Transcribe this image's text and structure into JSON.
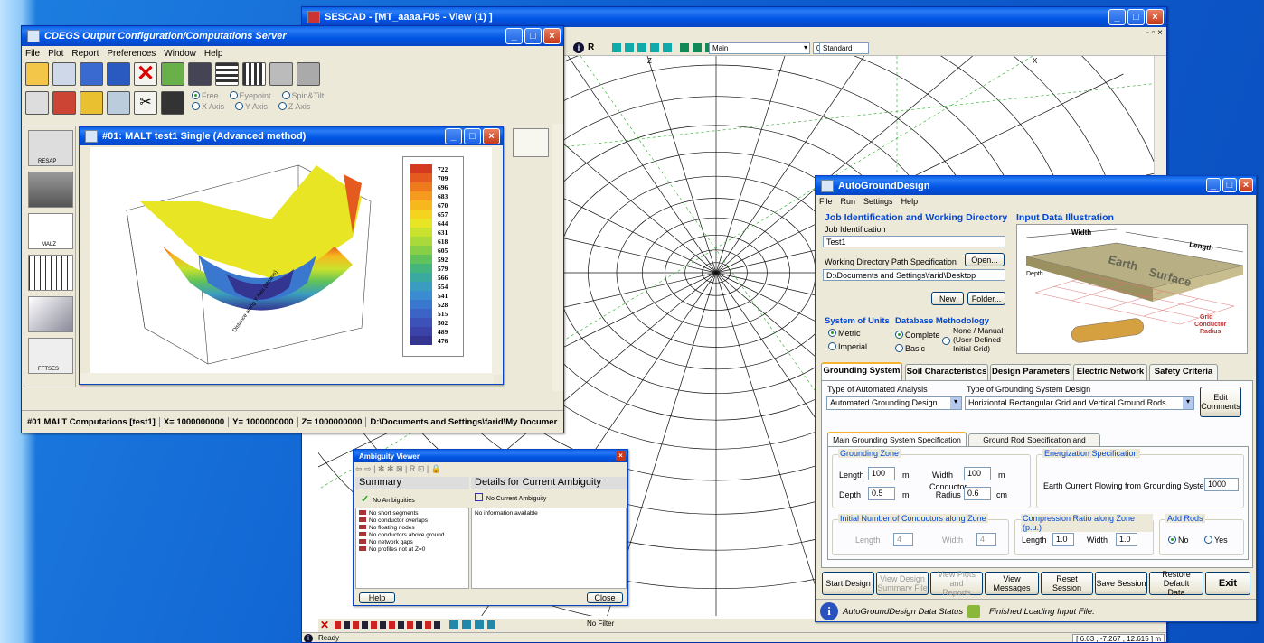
{
  "sescad": {
    "title": "SESCAD - [MT_aaaa.F05 - View (1) ]",
    "toolbar": {
      "view_select": "Main",
      "zoom_value": "0.5",
      "style_select": "Standard"
    },
    "axis_labels": [
      "Z",
      "X"
    ],
    "status_text": "Ready",
    "coords": "[  6.03  ,  -7.267  ,  12.615  ] m",
    "bottom_toolbar_filter": "No Filter"
  },
  "cdegs": {
    "title": "CDEGS Output Configuration/Computations  Server",
    "menu": [
      "File",
      "Plot",
      "Report",
      "Preferences",
      "Window",
      "Help"
    ],
    "view_options": [
      {
        "label": "Free",
        "selected": true
      },
      {
        "label": "Eyepoint",
        "selected": false
      },
      {
        "label": "Spin&Tilt",
        "selected": false
      },
      {
        "label": "X Axis",
        "selected": false
      },
      {
        "label": "Y Axis",
        "selected": false
      },
      {
        "label": "Z Axis",
        "selected": false
      }
    ],
    "side_tools": [
      "RESAP",
      "",
      "MALZ",
      "",
      "",
      "FFTSES"
    ],
    "plot_title": "#01: MALT test1 Single (Advanced method)",
    "axis_text": "Distance along Y Axis (Meters)",
    "legend_values": [
      "722",
      "709",
      "696",
      "683",
      "670",
      "657",
      "644",
      "631",
      "618",
      "605",
      "592",
      "579",
      "566",
      "554",
      "541",
      "528",
      "515",
      "502",
      "489",
      "476"
    ],
    "legend_colors": [
      "#d43a1f",
      "#e55a1f",
      "#ee7a1e",
      "#f59a1e",
      "#f7b81e",
      "#f4d41e",
      "#e7e524",
      "#c9e22d",
      "#a9d93a",
      "#87cf47",
      "#5fc25a",
      "#43b57d",
      "#3aa9a0",
      "#3a9cc0",
      "#3a8bd0",
      "#3a78d0",
      "#3b64c6",
      "#3c52b8",
      "#3b43a8",
      "#343590"
    ],
    "status": {
      "computation": "#01 MALT Computations [test1]",
      "x": "X= 1000000000",
      "y": "Y= 1000000000",
      "z": "Z= 1000000000",
      "path": "D:\\Documents and Settings\\farid\\My Documer"
    }
  },
  "ambiguity": {
    "title": "Ambiguity Viewer",
    "summary_header": "Summary",
    "details_header": "Details for Current Ambiguity",
    "summary_status": "No Ambiguities",
    "details_status": "No Current Ambiguity",
    "checks": [
      "No short segments",
      "No conductor overlaps",
      "No floating nodes",
      "No conductors above ground",
      "No network gaps",
      "No profiles not at Z=0"
    ],
    "details_text": "No information available",
    "help_label": "Help",
    "close_label": "Close"
  },
  "agd": {
    "title": "AutoGroundDesign",
    "menu": [
      "File",
      "Run",
      "Settings",
      "Help"
    ],
    "job_section": "Job Identification and Working Directory",
    "job_label": "Job Identification",
    "job_value": "Test1",
    "path_label": "Working Directory Path Specification",
    "open_label": "Open...",
    "path_value": "D:\\Documents and Settings\\farid\\Desktop",
    "new_label": "New",
    "folder_label": "Folder...",
    "illustration_title": "Input Data Illustration",
    "illus": {
      "width": "Width",
      "length": "Length",
      "depth": "Depth",
      "earth": "Earth",
      "surface": "Surface",
      "grid": "Grid",
      "conductor": "Conductor",
      "radius": "Radius"
    },
    "units_title": "System of Units",
    "units": [
      {
        "label": "Metric",
        "selected": true
      },
      {
        "label": "Imperial",
        "selected": false
      }
    ],
    "db_title": "Database Methodology",
    "db_options": [
      {
        "label": "Complete",
        "selected": true
      },
      {
        "label": "Basic",
        "selected": false
      }
    ],
    "db_manual": [
      "None / Manual",
      "(User-Defined",
      "Initial Grid)"
    ],
    "tabs": [
      "Grounding System",
      "Soil Characteristics",
      "Design Parameters",
      "Electric Network",
      "Safety Criteria"
    ],
    "analysis_label": "Type of Automated Analysis",
    "analysis_value": "Automated Grounding Design",
    "design_label": "Type of Grounding System Design",
    "design_value": "Horiziontal Rectangular Grid and Vertical Ground Rods",
    "edit_comments": [
      "Edit",
      "Comments"
    ],
    "subtabs": [
      "Main Grounding System Specification",
      "Ground Rod Specification and Options"
    ],
    "zone_title": "Grounding Zone",
    "length_label": "Length",
    "length_value": "100",
    "m": "m",
    "width_label": "Width",
    "width_value": "100",
    "depth_label": "Depth",
    "depth_value": "0.5",
    "radius_label": [
      "Conductor",
      "Radius"
    ],
    "radius_value": "0.6",
    "cm": "cm",
    "energ_title": "Energization Specification",
    "energ_label": "Earth Current Flowing from Grounding System (A)",
    "energ_value": "1000",
    "init_title": "Initial Number of Conductors along Zone",
    "init_length": "Length",
    "init_length_val": "4",
    "init_width": "Width",
    "init_width_val": "4",
    "comp_title": "Compression Ratio along Zone (p.u.)",
    "comp_length": "Length",
    "comp_length_val": "1.0",
    "comp_width": "Width",
    "comp_width_val": "1.0",
    "rods_title": "Add Rods",
    "rods": [
      {
        "label": "No",
        "selected": true
      },
      {
        "label": "Yes",
        "selected": false
      }
    ],
    "buttons": {
      "start": "Start Design",
      "view_design": [
        "View Design",
        "Summary File"
      ],
      "view_plots": [
        "View Plots and",
        "Reports"
      ],
      "view_messages": "View Messages",
      "reset": "Reset Session",
      "save": "Save Session",
      "restore": [
        "Restore Default",
        "Data"
      ],
      "exit": "Exit"
    },
    "data_status_label": "AutoGroundDesign Data Status",
    "data_status_value": "Finished Loading Input File."
  }
}
